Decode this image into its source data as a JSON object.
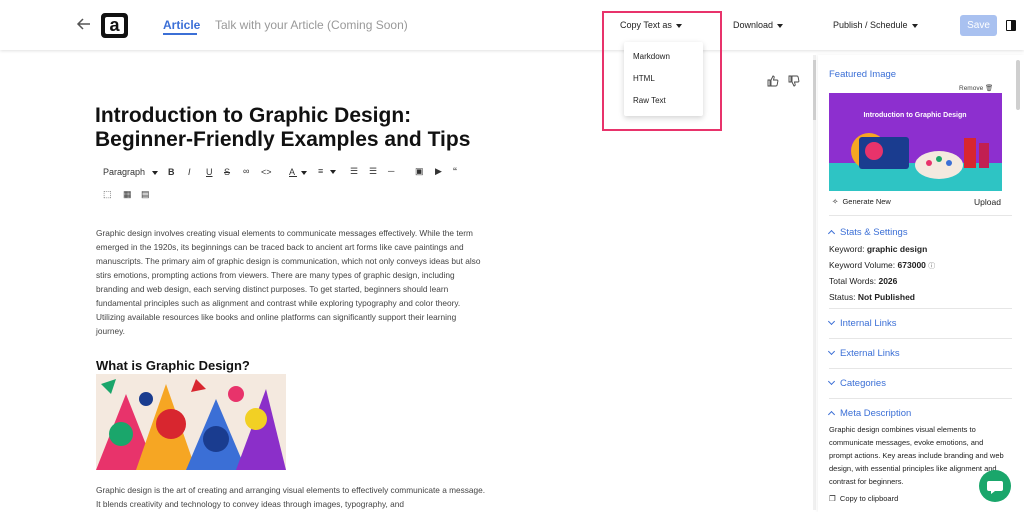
{
  "header": {
    "logo_letter": "a",
    "tabs": [
      {
        "label": "Article",
        "active": true
      },
      {
        "label": "Talk with your Article (Coming Soon)",
        "active": false
      }
    ],
    "copy_text_as": "Copy Text as",
    "download": "Download",
    "publish_schedule": "Publish / Schedule",
    "save": "Save"
  },
  "copy_menu": {
    "items": [
      "Markdown",
      "HTML",
      "Raw Text"
    ]
  },
  "editor": {
    "title": "Introduction to Graphic Design: Beginner-Friendly Examples and Tips",
    "paragraph_style": "Paragraph",
    "intro": "Graphic design involves creating visual elements to communicate messages effectively. While the term emerged in the 1920s, its beginnings can be traced back to ancient art forms like cave paintings and manuscripts. The primary aim of graphic design is communication, which not only conveys ideas but also stirs emotions, prompting actions from viewers. There are many types of graphic design, including branding and web design, each serving distinct purposes. To get started, beginners should learn fundamental principles such as alignment and contrast while exploring typography and color theory. Utilizing available resources like books and online platforms can significantly support their learning journey.",
    "h2": "What is Graphic Design?",
    "para2": "Graphic design is the art of creating and arranging visual elements to effectively communicate a message. It blends creativity and technology to convey ideas through images, typography, and"
  },
  "sidebar": {
    "featured_image": "Featured Image",
    "remove": "Remove",
    "image_caption": "Introduction to Graphic Design",
    "generate_new": "Generate New",
    "upload": "Upload",
    "stats_title": "Stats & Settings",
    "keyword_label": "Keyword:",
    "keyword_value": "graphic design",
    "volume_label": "Keyword Volume:",
    "volume_value": "673000",
    "words_label": "Total Words:",
    "words_value": "2026",
    "status_label": "Status:",
    "status_value": "Not Published",
    "internal_links": "Internal Links",
    "external_links": "External Links",
    "categories": "Categories",
    "meta_title": "Meta Description",
    "meta_text": "Graphic design combines visual elements to communicate messages, evoke emotions, and prompt actions. Key areas include branding and web design, with essential principles like alignment and contrast for beginners.",
    "copy_clipboard": "Copy to clipboard"
  },
  "colors": {
    "accent": "#3b6fd6",
    "highlight": "#e8336b",
    "save_disabled": "#a9c1f0",
    "chat": "#1aa66b"
  }
}
